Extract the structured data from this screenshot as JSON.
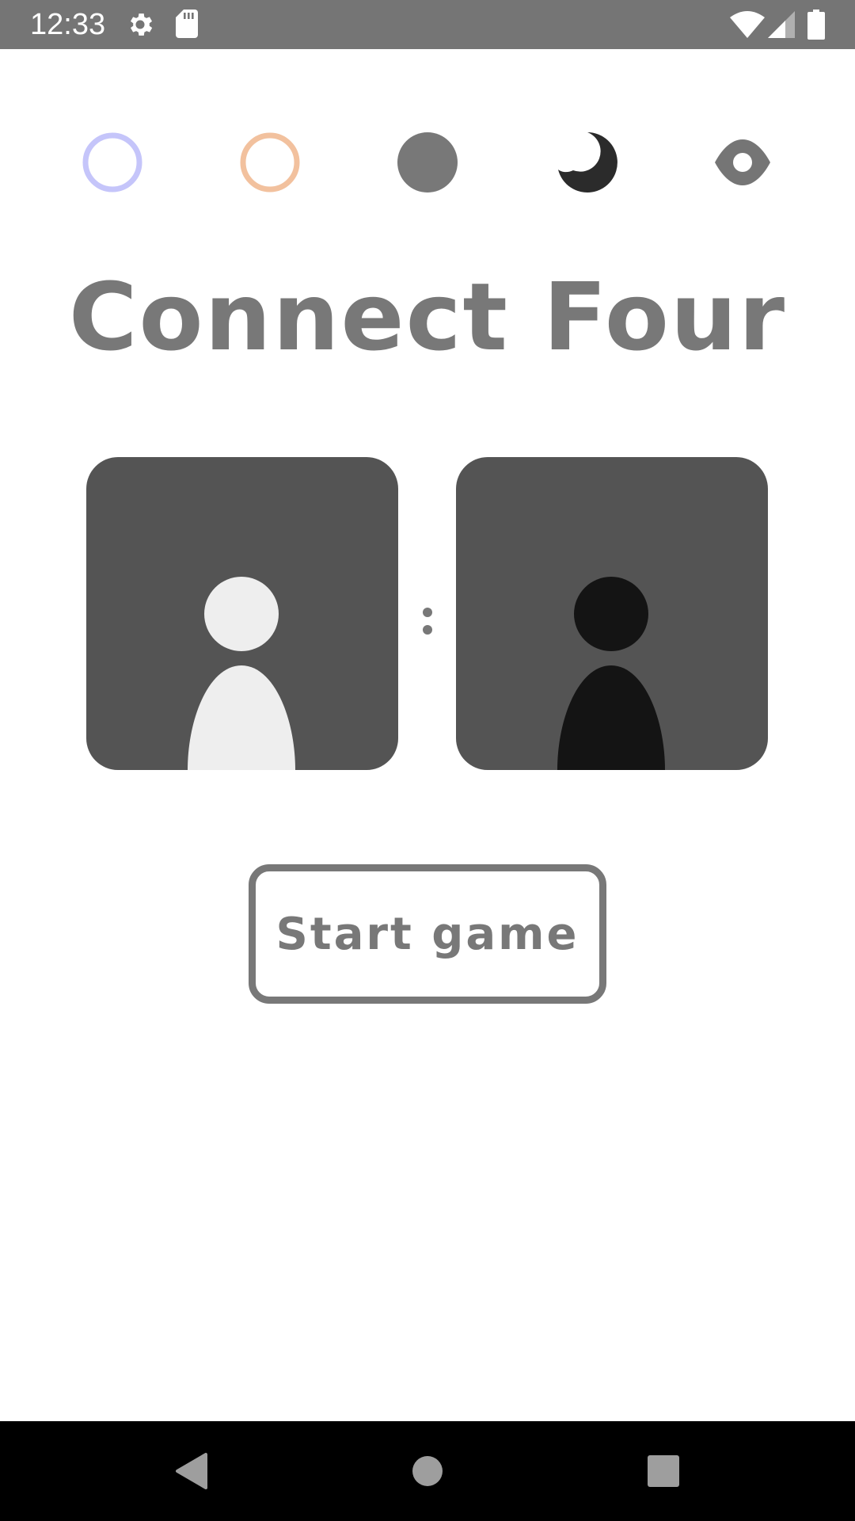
{
  "status_bar": {
    "time": "12:33",
    "background": "#757575",
    "icons": [
      "settings-icon",
      "sd-card-icon",
      "wifi-icon",
      "cell-signal-icon",
      "battery-icon"
    ]
  },
  "themes": {
    "options": [
      {
        "name": "lavender-ring",
        "color": "#c5c5fa"
      },
      {
        "name": "peach-ring",
        "color": "#f2c19e"
      },
      {
        "name": "gray-disc",
        "color": "#787878"
      },
      {
        "name": "dark-moon",
        "color": "#2b2b2b"
      },
      {
        "name": "eye",
        "color": "#757575"
      }
    ]
  },
  "title": "Connect Four",
  "players": {
    "card_color": "#545454",
    "player_one_color": "#eeeeee",
    "player_two_color": "#141414",
    "separator": ":"
  },
  "start_button": {
    "label": "Start game"
  },
  "nav_bar": {
    "icons": [
      "back-icon",
      "home-icon",
      "recents-icon"
    ]
  }
}
